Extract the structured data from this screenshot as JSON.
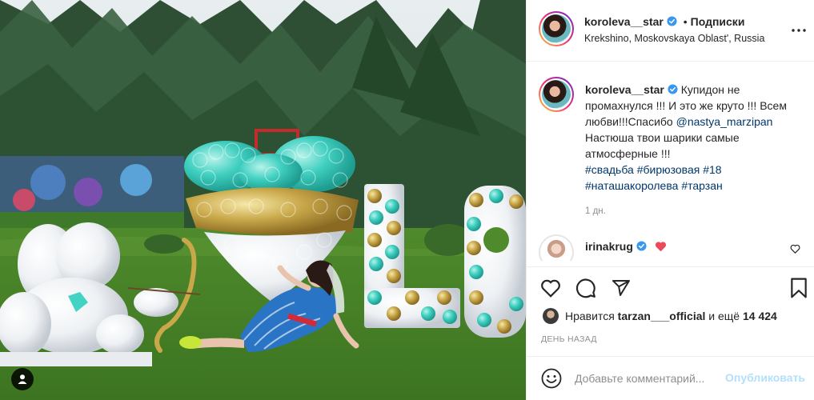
{
  "post": {
    "author": "koroleva__star",
    "follow_state": "Подписки",
    "separator": "•",
    "location": "Krekshino, Moskovskaya Oblast', Russia",
    "caption_plain_1": "Купидон не промахнулся !!! И это же круто !!! Всем любви!!!Спасибо",
    "caption_mention": "@nastya_marzipan",
    "caption_plain_2": "Настюша твои шарики самые атмосферные !!!",
    "hashtags": [
      "#свадьба",
      "#бирюзовая",
      "#18",
      "#наташакоролева",
      "#тарзан"
    ],
    "age": "1 дн.",
    "date": "ДЕНЬ НАЗАД"
  },
  "comment": {
    "author": "irinakrug"
  },
  "likes": {
    "prefix": "Нравится",
    "user": "tarzan___official",
    "middle": "и ещё",
    "count": "14 424"
  },
  "add_comment": {
    "placeholder": "Добавьте комментарий...",
    "publish_label": "Опубликовать"
  },
  "icons": {
    "more": "more-horizontal-icon",
    "verified": "verified-badge-icon",
    "like": "heart-outline-icon",
    "comment": "speech-bubble-icon",
    "share": "paper-plane-icon",
    "save": "bookmark-icon",
    "emoji": "smiley-icon",
    "user_tags": "person-icon"
  },
  "colors": {
    "verified_blue": "#3897f0",
    "link_blue": "#00376b",
    "muted_gray": "#8e8e8e",
    "publish_disabled": "#b2dffc",
    "heart_red": "#ed4956"
  }
}
